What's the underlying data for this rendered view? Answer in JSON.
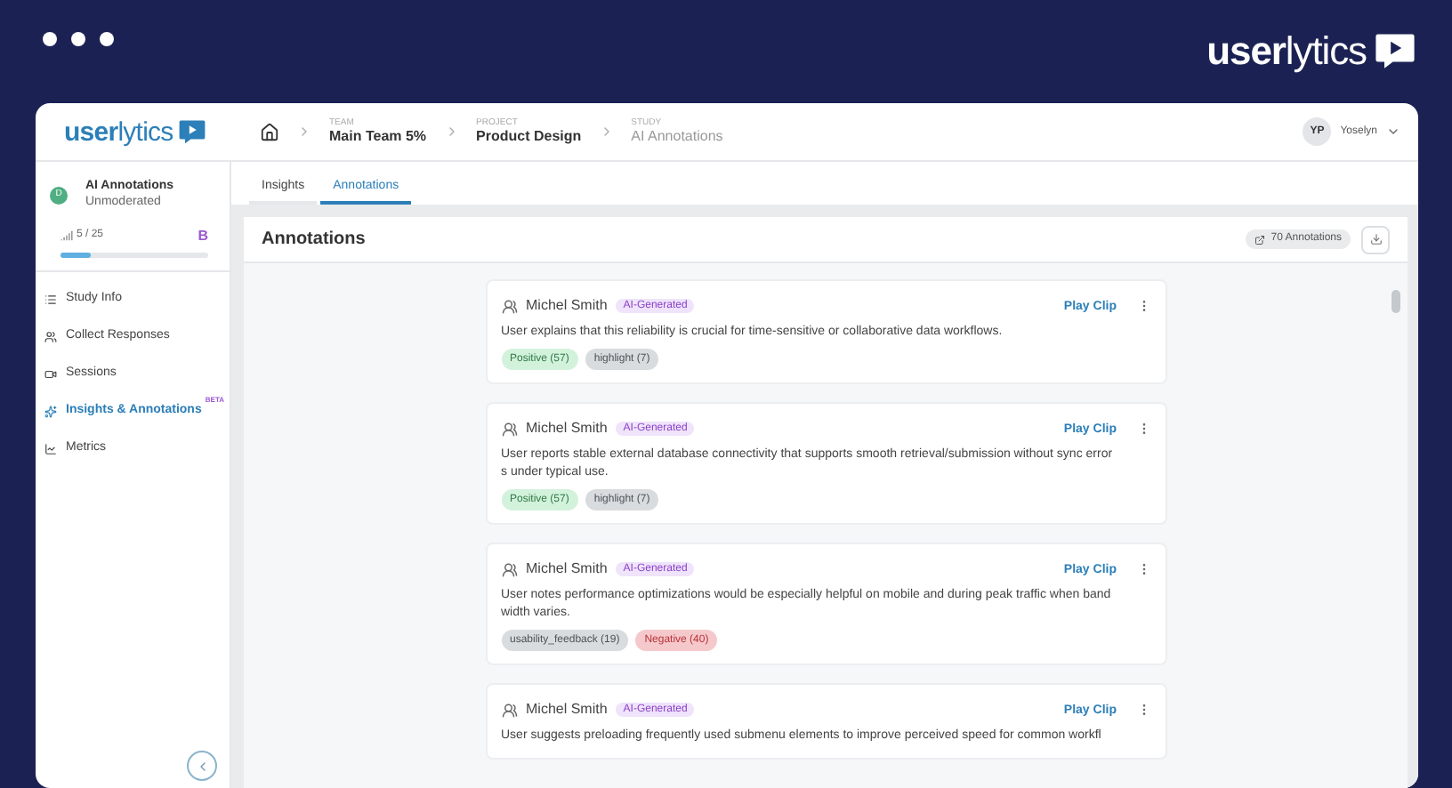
{
  "frame": {
    "logo": "**user**lytics"
  },
  "header": {
    "logo": "**user**lytics",
    "breadcrumbs": [
      {
        "label": "TEAM",
        "value": "Main Team 5%",
        "current": false
      },
      {
        "label": "PROJECT",
        "value": "Product Design",
        "current": false
      },
      {
        "label": "STUDY",
        "value": "AI Annotations",
        "current": true
      }
    ],
    "user": {
      "initials": "YP",
      "name": "Yoselyn"
    }
  },
  "sidebar": {
    "study": {
      "initial": "D",
      "title": "AI Annotations",
      "subtitle": "Unmoderated"
    },
    "progress": {
      "reading": "5 / 25",
      "level": 0.2,
      "plan": "B"
    },
    "items": [
      {
        "label": "Study Info",
        "selected": false
      },
      {
        "label": "Collect Responses",
        "selected": false
      },
      {
        "label": "Sessions",
        "selected": false
      },
      {
        "label": "Insights & Annotations",
        "selected": true,
        "badge": "BETA"
      },
      {
        "label": "Metrics",
        "selected": false
      }
    ]
  },
  "tabs": [
    {
      "label": "Insights",
      "selected": false
    },
    {
      "label": "Annotations",
      "selected": true
    }
  ],
  "panel": {
    "title": "Annotations",
    "count": "70 Annotations"
  },
  "annotations": [
    {
      "author": "Michel Smith",
      "badge": "AI-Generated",
      "action": "Play Clip",
      "text": "User explains that this reliability is crucial for time-sensitive or collaborative data workflows.",
      "tags": [
        {
          "label": "Positive (57)",
          "kind": "positive"
        },
        {
          "label": "highlight (7)",
          "kind": "neutral"
        }
      ]
    },
    {
      "author": "Michel Smith",
      "badge": "AI-Generated",
      "action": "Play Clip",
      "text": "User reports stable external database connectivity that supports smooth retrieval/submission without sync errors under typical use.",
      "tags": [
        {
          "label": "Positive (57)",
          "kind": "positive"
        },
        {
          "label": "highlight (7)",
          "kind": "neutral"
        }
      ]
    },
    {
      "author": "Michel Smith",
      "badge": "AI-Generated",
      "action": "Play Clip",
      "text": "User notes performance optimizations would be especially helpful on mobile and during peak traffic when bandwidth varies.",
      "tags": [
        {
          "label": "usability_feedback (19)",
          "kind": "neutral"
        },
        {
          "label": "Negative (40)",
          "kind": "negative"
        }
      ]
    },
    {
      "author": "Michel Smith",
      "badge": "AI-Generated",
      "action": "Play Clip",
      "text": "User suggests preloading frequently used submenu elements to improve perceived speed for common workfl"
    }
  ]
}
